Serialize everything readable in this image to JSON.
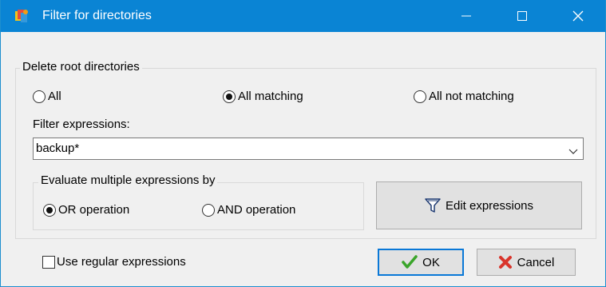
{
  "window": {
    "title": "Filter for directories"
  },
  "root_group": {
    "label": "Delete root directories",
    "options": [
      {
        "label": "All",
        "selected": false
      },
      {
        "label": "All matching",
        "selected": true
      },
      {
        "label": "All not matching",
        "selected": false
      }
    ]
  },
  "filter": {
    "label": "Filter expressions:",
    "value": "backup*"
  },
  "evaluate_group": {
    "label": "Evaluate multiple expressions by",
    "options": [
      {
        "label": "OR operation",
        "selected": true
      },
      {
        "label": "AND operation",
        "selected": false
      }
    ]
  },
  "buttons": {
    "edit": "Edit expressions",
    "ok": "OK",
    "cancel": "Cancel"
  },
  "regex_checkbox": {
    "label": "Use regular expressions",
    "checked": false
  },
  "colors": {
    "titlebar": "#0a84d4",
    "accent": "#0a78d7",
    "ok_check": "#3aa52a",
    "cancel_x": "#d9342b"
  },
  "icons": {
    "app": "app-icon",
    "edit": "funnel-icon",
    "ok": "checkmark-icon",
    "cancel": "cross-icon"
  }
}
